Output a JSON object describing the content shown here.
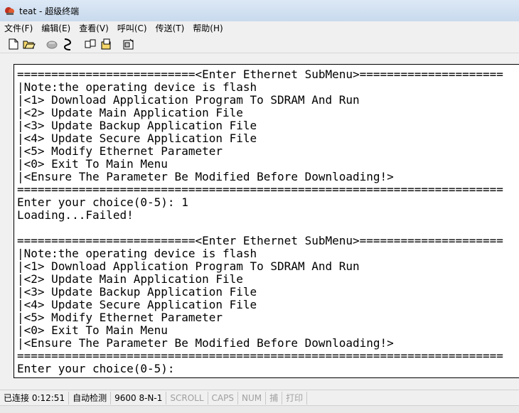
{
  "window": {
    "title": "teat - 超级终端"
  },
  "menu": [
    "文件(F)",
    "编辑(E)",
    "查看(V)",
    "呼叫(C)",
    "传送(T)",
    "帮助(H)"
  ],
  "toolbar": {
    "buttons": [
      "new-icon",
      "open-icon",
      "disconnected-phone-icon",
      "connect-icon",
      "send-icon",
      "receive-icon",
      "properties-icon"
    ]
  },
  "terminal": {
    "lines": [
      "==========================<Enter Ethernet SubMenu>=====================",
      "|Note:the operating device is flash",
      "|<1> Download Application Program To SDRAM And Run",
      "|<2> Update Main Application File",
      "|<3> Update Backup Application File",
      "|<4> Update Secure Application File",
      "|<5> Modify Ethernet Parameter",
      "|<0> Exit To Main Menu",
      "|<Ensure The Parameter Be Modified Before Downloading!>",
      "=======================================================================",
      "Enter your choice(0-5): 1",
      "Loading...Failed!",
      "",
      "==========================<Enter Ethernet SubMenu>=====================",
      "|Note:the operating device is flash",
      "|<1> Download Application Program To SDRAM And Run",
      "|<2> Update Main Application File",
      "|<3> Update Backup Application File",
      "|<4> Update Secure Application File",
      "|<5> Modify Ethernet Parameter",
      "|<0> Exit To Main Menu",
      "|<Ensure The Parameter Be Modified Before Downloading!>",
      "=======================================================================",
      "Enter your choice(0-5): "
    ]
  },
  "status": {
    "connected": "已连接 0:12:51",
    "detect": "自动检测",
    "baud": "9600 8-N-1",
    "scroll": "SCROLL",
    "caps": "CAPS",
    "num": "NUM",
    "capture": "捕",
    "print": "打印"
  }
}
